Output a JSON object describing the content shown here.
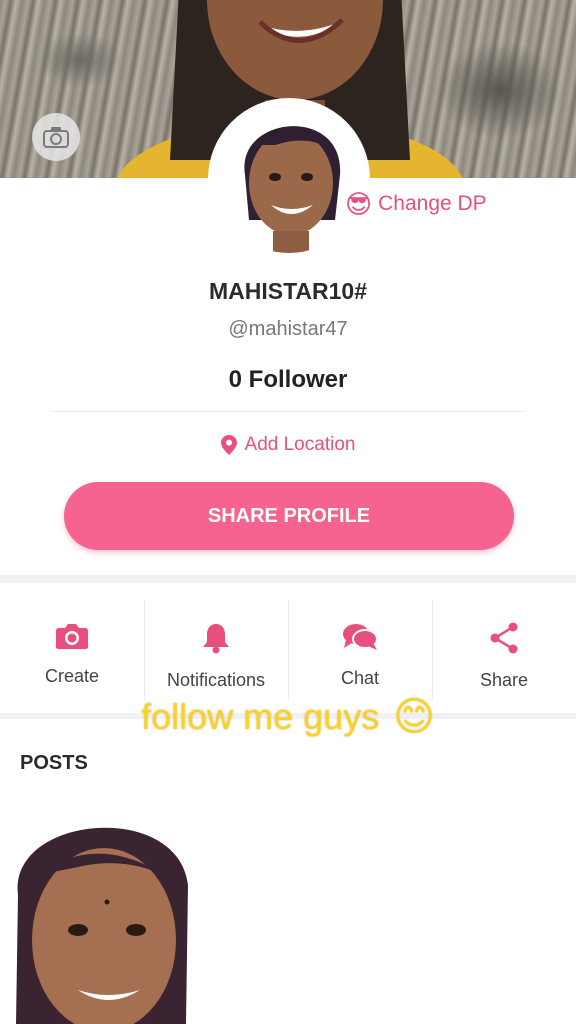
{
  "cover": {
    "camera_icon": "camera-icon"
  },
  "profile": {
    "change_dp_label": "Change DP",
    "change_dp_emoji": "😎",
    "name": "MAHISTAR10#",
    "handle": "@mahistar47",
    "followers": "0 Follower",
    "location_label": "Add Location",
    "share_label": "SHARE PROFILE"
  },
  "actions": [
    {
      "label": "Create",
      "icon": "camera-icon"
    },
    {
      "label": "Notifications",
      "icon": "bell-icon"
    },
    {
      "label": "Chat",
      "icon": "chat-icon"
    },
    {
      "label": "Share",
      "icon": "share-icon"
    }
  ],
  "overlay": {
    "text": "follow me guys",
    "emoji": "😊"
  },
  "posts": {
    "title": "POSTS"
  },
  "colors": {
    "accent": "#f7638f",
    "pink_text": "#e84f7d",
    "overlay": "#ffd21a"
  }
}
